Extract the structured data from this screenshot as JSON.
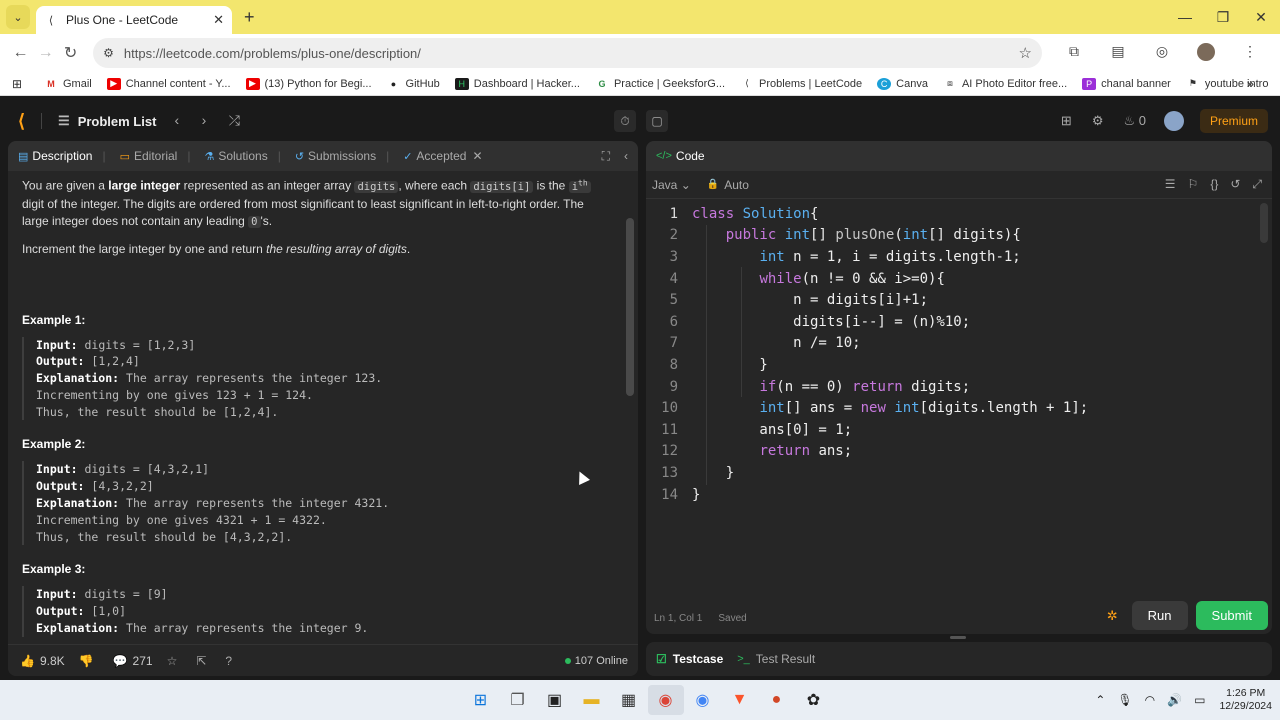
{
  "browser": {
    "tab_title": "Plus One - LeetCode",
    "url": "https://leetcode.com/problems/plus-one/description/",
    "bookmarks": [
      {
        "label": "Gmail",
        "icon": "gmail-icon"
      },
      {
        "label": "Channel content - Y...",
        "icon": "youtube-icon"
      },
      {
        "label": "(13) Python for Begi...",
        "icon": "youtube-icon"
      },
      {
        "label": "GitHub",
        "icon": "github-icon"
      },
      {
        "label": "Dashboard | Hacker...",
        "icon": "hackerrank-icon"
      },
      {
        "label": "Practice | GeeksforG...",
        "icon": "gfg-icon"
      },
      {
        "label": "Problems | LeetCode",
        "icon": "leetcode-icon"
      },
      {
        "label": "Canva",
        "icon": "canva-icon"
      },
      {
        "label": "AI Photo Editor free...",
        "icon": "photo-icon"
      },
      {
        "label": "chanal banner",
        "icon": "picsart-icon"
      },
      {
        "label": "youtube intro",
        "icon": "flag-icon"
      }
    ]
  },
  "nav": {
    "problem_list": "Problem List",
    "streak": "0",
    "premium": "Premium"
  },
  "left_tabs": [
    {
      "label": "Description"
    },
    {
      "label": "Editorial"
    },
    {
      "label": "Solutions"
    },
    {
      "label": "Submissions"
    },
    {
      "label": "Accepted"
    }
  ],
  "problem": {
    "p1_a": "You are given a ",
    "p1_b": "large integer",
    "p1_c": " represented as an integer array ",
    "p1_code1": "digits",
    "p1_d": ", where each ",
    "p1_code2": "digits[i]",
    "p1_e": " is the ",
    "p1_sup_i": "i",
    "p1_sup": "th",
    "p1_f": " digit of the integer. The digits are ordered from most significant to least significant in left-to-right order. The large integer does not contain any leading ",
    "p1_code3": "0",
    "p1_g": "'s.",
    "p2_a": "Increment the large integer by one and return ",
    "p2_b": "the resulting array of digits",
    "p2_c": ".",
    "examples": [
      {
        "title": "Example 1:",
        "input_label": "Input:",
        "input": " digits = [1,2,3]",
        "output_label": "Output:",
        "output": " [1,2,4]",
        "expl_label": "Explanation:",
        "expl": " The array represents the integer 123.",
        "l2": "Incrementing by one gives 123 + 1 = 124.",
        "l3": "Thus, the result should be [1,2,4]."
      },
      {
        "title": "Example 2:",
        "input_label": "Input:",
        "input": " digits = [4,3,2,1]",
        "output_label": "Output:",
        "output": " [4,3,2,2]",
        "expl_label": "Explanation:",
        "expl": " The array represents the integer 4321.",
        "l2": "Incrementing by one gives 4321 + 1 = 4322.",
        "l3": "Thus, the result should be [4,3,2,2]."
      },
      {
        "title": "Example 3:",
        "input_label": "Input:",
        "input": " digits = [9]",
        "output_label": "Output:",
        "output": " [1,0]",
        "expl_label": "Explanation:",
        "expl": " The array represents the integer 9."
      }
    ]
  },
  "left_bottom": {
    "likes": "9.8K",
    "comments": "271",
    "online": "107 Online"
  },
  "code_panel": {
    "title": "Code",
    "language": "Java",
    "mode": "Auto",
    "status_pos": "Ln 1, Col 1",
    "status_saved": "Saved",
    "run": "Run",
    "submit": "Submit"
  },
  "code_lines": [
    "class Solution{",
    "    public int[] plusOne(int[] digits){",
    "        int n = 1, i = digits.length-1;",
    "        while(n != 0 && i>=0){",
    "            n = digits[i]+1;",
    "            digits[i--] = (n)%10;",
    "            n /= 10;",
    "        }",
    "        if(n == 0) return digits;",
    "        int[] ans = new int[digits.length + 1];",
    "        ans[0] = 1;",
    "        return ans;",
    "    }",
    "}"
  ],
  "bottom_tabs": {
    "testcase": "Testcase",
    "test_result": "Test Result"
  },
  "taskbar": {
    "time": "1:26 PM",
    "date": "12/29/2024"
  }
}
